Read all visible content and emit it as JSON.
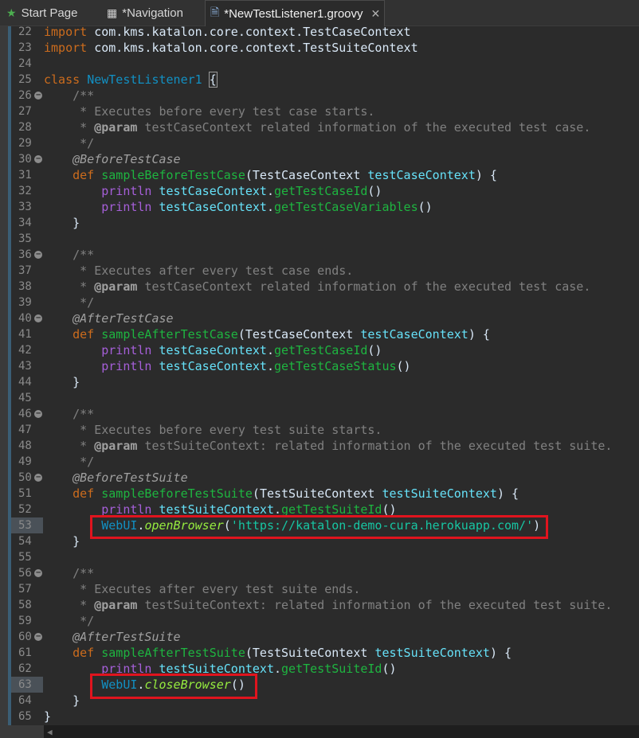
{
  "tabs": [
    {
      "label": "Start Page",
      "icon": "star-icon"
    },
    {
      "label": "*Navigation",
      "icon": "table-icon"
    },
    {
      "label": "*NewTestListener1.groovy",
      "icon": "groovy-file-icon",
      "close": "✕"
    }
  ],
  "colors": {
    "highlight_box": "#e0141e",
    "keyword": "#cc6c1d",
    "method": "#1eb540"
  },
  "editor": {
    "line_numbers": [
      "22",
      "23",
      "24",
      "25",
      "26",
      "27",
      "28",
      "29",
      "30",
      "31",
      "32",
      "33",
      "34",
      "35",
      "36",
      "37",
      "38",
      "39",
      "40",
      "41",
      "42",
      "43",
      "44",
      "45",
      "46",
      "47",
      "48",
      "49",
      "50",
      "51",
      "52",
      "53",
      "54",
      "55",
      "56",
      "57",
      "58",
      "59",
      "60",
      "61",
      "62",
      "63",
      "64",
      "65"
    ],
    "lines": {
      "l22_kw": "import",
      "l22_rest": " com.kms.katalon.core.context.TestCaseContext",
      "l23_kw": "import",
      "l23_rest": " com.kms.katalon.core.context.TestSuiteContext",
      "l25_kw": "class",
      "l25_name": "NewTestListener1",
      "l25_brace": "{",
      "c_open": "/**",
      "c_close": "*/",
      "c_star": "*",
      "l27": "Executes before every test case starts.",
      "param_tag": "@param",
      "l28_rest": "testCaseContext related information of the executed test case.",
      "l30": "@BeforeTestCase",
      "def": "def",
      "l31_name": "sampleBeforeTestCase",
      "l31_sig": "TestCaseContext",
      "l31_var": "testCaseContext",
      "println": "println",
      "tcc": "testCaseContext",
      "getTestCaseId": "getTestCaseId",
      "getTestCaseVariables": "getTestCaseVariables",
      "l37": "Executes after every test case ends.",
      "l40": "@AfterTestCase",
      "l41_name": "sampleAfterTestCase",
      "getTestCaseStatus": "getTestCaseStatus",
      "l47": "Executes before every test suite starts.",
      "l48_rest": "testSuiteContext: related information of the executed test suite.",
      "l50": "@BeforeTestSuite",
      "l51_name": "sampleBeforeTestSuite",
      "tsc_type": "TestSuiteContext",
      "tsc": "testSuiteContext",
      "getTestSuiteId": "getTestSuiteId",
      "webui": "WebUI",
      "openBrowser": "openBrowser",
      "url": "'https://katalon-demo-cura.herokuapp.com/'",
      "l57": "Executes after every test suite ends.",
      "l60": "@AfterTestSuite",
      "l61_name": "sampleAfterTestSuite",
      "closeBrowser": "closeBrowser"
    }
  }
}
